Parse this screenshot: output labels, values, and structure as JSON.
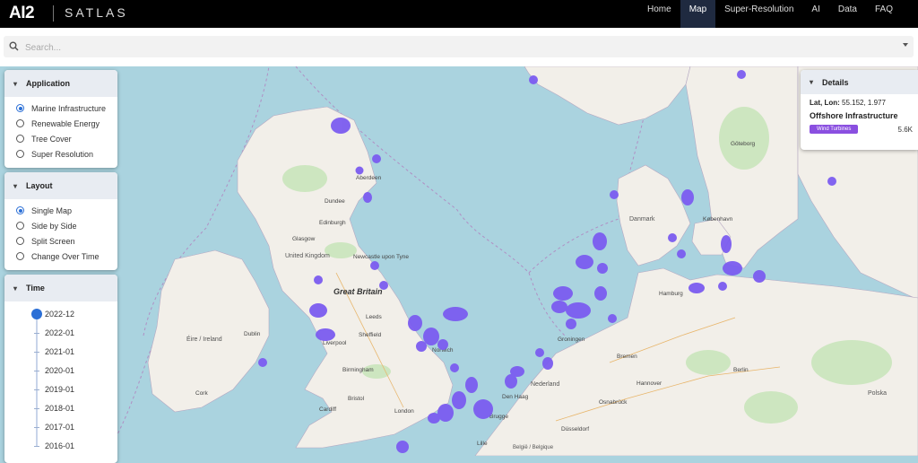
{
  "app": {
    "logo": "AI2",
    "name": "SATLAS"
  },
  "nav": [
    {
      "label": "Home",
      "active": false
    },
    {
      "label": "Map",
      "active": true
    },
    {
      "label": "Super-Resolution",
      "active": false
    },
    {
      "label": "AI",
      "active": false
    },
    {
      "label": "Data",
      "active": false
    },
    {
      "label": "FAQ",
      "active": false
    }
  ],
  "search": {
    "placeholder": "Search...",
    "value": ""
  },
  "application_panel": {
    "title": "Application",
    "options": [
      "Marine Infrastructure",
      "Renewable Energy",
      "Tree Cover",
      "Super Resolution"
    ],
    "selected": "Marine Infrastructure"
  },
  "layout_panel": {
    "title": "Layout",
    "options": [
      "Single Map",
      "Side by Side",
      "Split Screen",
      "Change Over Time"
    ],
    "selected": "Single Map"
  },
  "time_panel": {
    "title": "Time",
    "dates": [
      "2022-12",
      "2022-01",
      "2021-01",
      "2020-01",
      "2019-01",
      "2018-01",
      "2017-01",
      "2016-01"
    ],
    "selected": "2022-12"
  },
  "details": {
    "title": "Details",
    "latlon_label": "Lat, Lon:",
    "latlon_value": "55.152, 1.977",
    "category": "Offshore Infrastructure",
    "chip_label": "Wind Turbines",
    "chip_value": "5.6K"
  },
  "map_labels": {
    "great_britain": "Great Britain",
    "united_kingdom": "United Kingdom",
    "eire": "Éire / Ireland",
    "danmark": "Danmark",
    "nederland": "Nederland",
    "belgie": "België / Belgique",
    "edinburgh": "Edinburgh",
    "glasgow": "Glasgow",
    "dundee": "Dundee",
    "aberdeen": "Aberdeen",
    "newcastle": "Newcastle upon Tyne",
    "leeds": "Leeds",
    "sheffield": "Sheffield",
    "liverpool": "Liverpool",
    "birmingham": "Birmingham",
    "london": "London",
    "cardiff": "Cardiff",
    "bristol": "Bristol",
    "dublin": "Dublin",
    "cork": "Cork",
    "den_haag": "Den Haag",
    "groningen": "Groningen",
    "bremen": "Bremen",
    "hannover": "Hannover",
    "berlin": "Berlin",
    "dusseldorf": "Düsseldorf",
    "goteborg": "Göteborg",
    "kobenhavn": "København",
    "hamburg": "Hamburg",
    "norwich": "Norwich",
    "lille": "Lille",
    "brugge": "Brugge",
    "osnabruck": "Osnabrück",
    "polska": "Polska"
  },
  "colors": {
    "accent": "#2b6fd6",
    "marker": "#7b5cf0",
    "chip": "#8a4fe0",
    "sea": "#aad3df",
    "land": "#f2efe9",
    "park": "#cde6c0"
  }
}
